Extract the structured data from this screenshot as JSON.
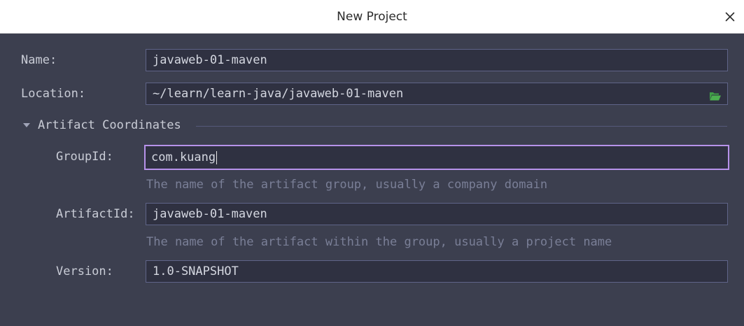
{
  "window": {
    "title": "New Project",
    "close_icon": "close-icon"
  },
  "form": {
    "name_label": "Name:",
    "name_value": "javaweb-01-maven",
    "location_label": "Location:",
    "location_value": "~/learn/learn-java/javaweb-01-maven",
    "browse_icon": "folder-icon",
    "section_title": "Artifact Coordinates",
    "section_expanded": true,
    "groupid_label": "GroupId:",
    "groupid_value": "com.kuang",
    "groupid_hint": "The name of the artifact group, usually a company domain",
    "artifactid_label": "ArtifactId:",
    "artifactid_value": "javaweb-01-maven",
    "artifactid_hint": "The name of the artifact within the group, usually a project name",
    "version_label": "Version:",
    "version_value": "1.0-SNAPSHOT"
  },
  "colors": {
    "background": "#3c3f4f",
    "field_background": "#2f3141",
    "field_border": "#5f6488",
    "focus_border": "#b792ea",
    "hint_text": "#7a7f97",
    "folder_icon": "#4caf50"
  }
}
